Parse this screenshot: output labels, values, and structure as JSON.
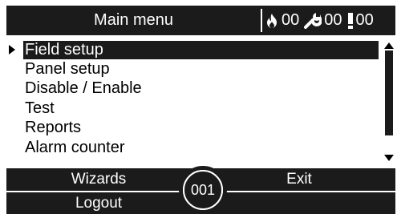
{
  "header": {
    "title": "Main menu",
    "status": [
      {
        "icon": "fire-icon",
        "value": "00"
      },
      {
        "icon": "wrench-icon",
        "value": "00"
      },
      {
        "icon": "exclamation-icon",
        "value": "00"
      }
    ]
  },
  "menu": {
    "items": [
      {
        "label": "Field setup",
        "selected": true
      },
      {
        "label": "Panel setup",
        "selected": false
      },
      {
        "label": "Disable / Enable",
        "selected": false
      },
      {
        "label": "Test",
        "selected": false
      },
      {
        "label": "Reports",
        "selected": false
      },
      {
        "label": "Alarm counter",
        "selected": false
      }
    ]
  },
  "softkeys": {
    "wizards": "Wizards",
    "exit": "Exit",
    "logout": "Logout"
  },
  "counter": "001",
  "colors": {
    "bar_background": "#1b1b1b",
    "text_light": "#ffffff",
    "text_dark": "#000000"
  }
}
